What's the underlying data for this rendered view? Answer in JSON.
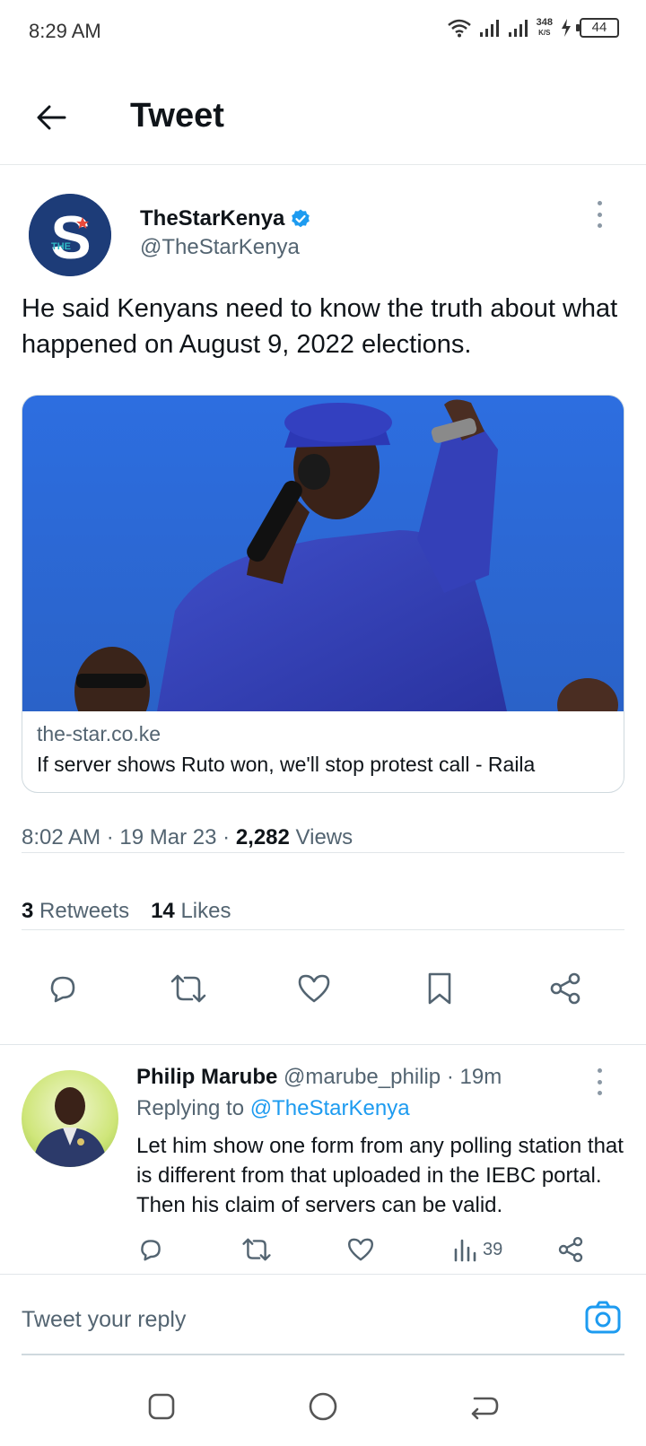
{
  "status_bar": {
    "time": "8:29 AM",
    "net_speed_value": "348",
    "net_speed_unit": "K/S",
    "battery": "44"
  },
  "app_bar": {
    "title": "Tweet"
  },
  "tweet": {
    "author_name": "TheStarKenya",
    "author_handle": "@TheStarKenya",
    "avatar_letter": "S",
    "avatar_small": "THE",
    "text": "He said Kenyans need to know the truth about what happened on August 9, 2022 elections.",
    "card": {
      "domain": "the-star.co.ke",
      "title": "If server shows Ruto won, we'll stop protest call - Raila"
    },
    "time": "8:02 AM",
    "date": "19 Mar 23",
    "views_count": "2,282",
    "views_label": "Views",
    "retweets_count": "3",
    "retweets_label": "Retweets",
    "likes_count": "14",
    "likes_label": "Likes"
  },
  "reply": {
    "name": "Philip Marube",
    "handle": "@marube_philip",
    "age": "19m",
    "replying_prefix": "Replying to",
    "replying_to": "@TheStarKenya",
    "text": "Let him show one form from any polling station that is different from that uploaded in the IEBC portal. Then his claim of servers can be valid.",
    "views": "39"
  },
  "compose": {
    "placeholder": "Tweet your reply"
  },
  "colors": {
    "accent": "#1d9bf0",
    "text": "#0f1419",
    "secondary": "#536471"
  }
}
